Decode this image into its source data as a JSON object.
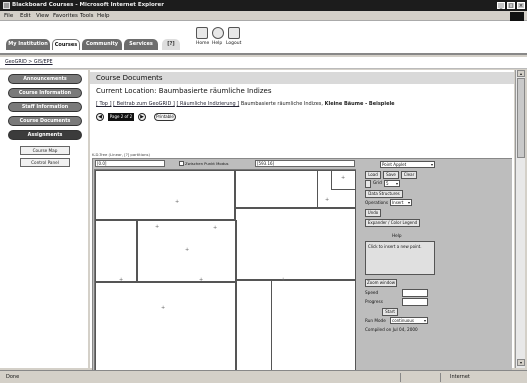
{
  "window": {
    "title": "Blackboard Courses - Microsoft Internet Explorer",
    "controls": [
      "_",
      "□",
      "×"
    ]
  },
  "menu": [
    "File",
    "Edit",
    "View",
    "Favorites",
    "Tools",
    "Help"
  ],
  "header": {
    "tabs": [
      "My Institution",
      "Courses",
      "Community",
      "Services",
      "[?]"
    ],
    "icons": [
      {
        "name": "home",
        "label": "Home"
      },
      {
        "name": "help",
        "label": "Help"
      },
      {
        "name": "logout",
        "label": "Logout"
      }
    ]
  },
  "crumb": "GeoGRID > GIS/EPE",
  "nav": {
    "buttons": [
      "Announcements",
      "Course Information",
      "Staff Information",
      "Course Documents",
      "Assignments"
    ],
    "active": "Assignments",
    "sub": [
      "Course Map",
      "Control Panel"
    ]
  },
  "main": {
    "page_title": "Course Documents",
    "location_prefix": "Current Location:",
    "location_value": "Baumbasierte räumliche Indizes",
    "path": {
      "top": "[ Top ]",
      "p1": "[ Beitrab zum GeoGRID ]",
      "p2": "[ Räumliche Indizierung ]",
      "p3": "Baumbasierte räumliche Indizes,",
      "p4": "Kleine Bäume - Beispiele"
    },
    "pager": {
      "prev": "◀",
      "page_of": "Page 2 of 2",
      "next": "▶",
      "print": "Printable"
    }
  },
  "applet": {
    "caption": "K-D-Tree (Linear, [?] partitions)",
    "coord_x": "[0.0]",
    "checkbox_label": "Zwischen Punkt Modus",
    "coord_y": "[593.16]",
    "controls": {
      "dropdown_top": "Point Applet",
      "load": "Load",
      "save": "Save",
      "clear": "Clear",
      "grid_label": "Grid",
      "grid_value": "5",
      "data_structures": "Data Structures",
      "operations_label": "Operations",
      "operations_value": "Insert",
      "undo": "Undo",
      "legend": "Expander / Color Legend",
      "help_title": "Help",
      "help_text": "Click to insert a new point.",
      "zoom": "Zoom window",
      "speed_label": "Speed",
      "progress_label": "Progress",
      "start": "Start",
      "run_mode_label": "Run Mode",
      "run_mode_value": "continuous",
      "compiled": "Compiled on Jul 04, 2000"
    }
  },
  "status": {
    "text": "Done",
    "zone": "Internet"
  }
}
